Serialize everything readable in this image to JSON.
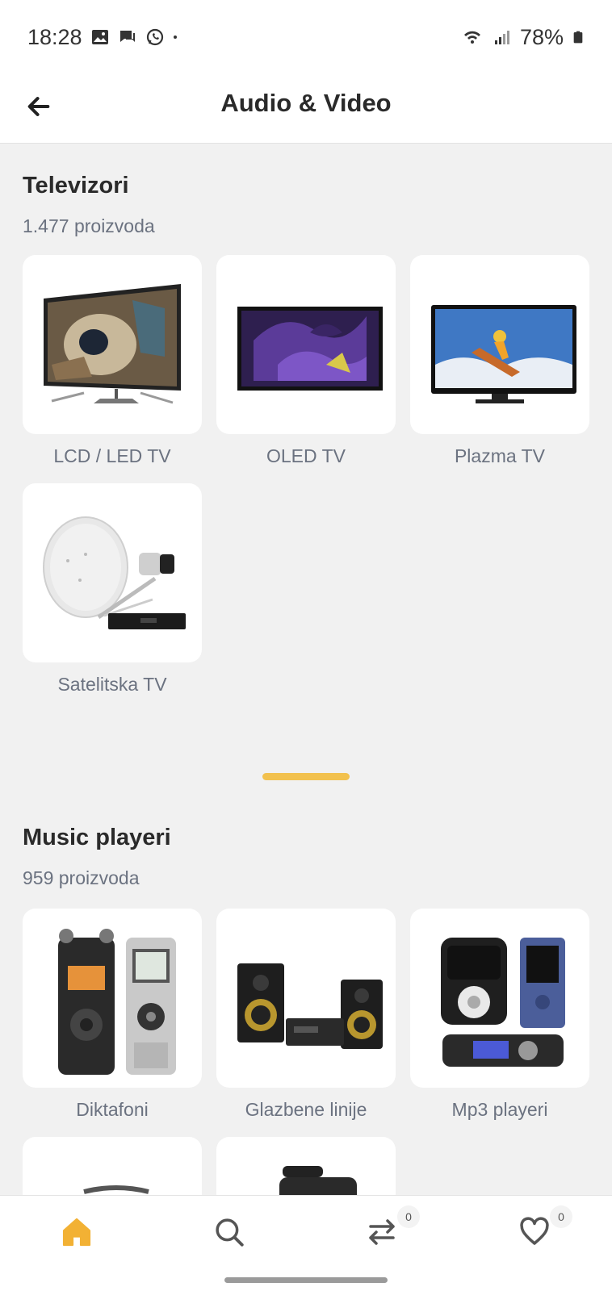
{
  "status_bar": {
    "time": "18:28",
    "battery": "78%",
    "icons_left": [
      "gallery-icon",
      "chat-icon",
      "whatsapp-icon",
      "dot-icon"
    ],
    "icons_right": [
      "wifi-icon",
      "signal-icon",
      "battery-icon"
    ]
  },
  "header": {
    "title": "Audio & Video",
    "back_icon": "arrow-left-icon"
  },
  "sections": [
    {
      "title": "Televizori",
      "count": "1.477 proizvoda",
      "items": [
        {
          "label": "LCD / LED TV"
        },
        {
          "label": "OLED TV"
        },
        {
          "label": "Plazma TV"
        },
        {
          "label": "Satelitska TV"
        }
      ]
    },
    {
      "title": "Music playeri",
      "count": "959 proizvoda",
      "items": [
        {
          "label": "Diktafoni"
        },
        {
          "label": "Glazbene linije"
        },
        {
          "label": "Mp3 playeri"
        },
        {
          "label": ""
        },
        {
          "label": ""
        }
      ]
    }
  ],
  "bottom_nav": {
    "items": [
      {
        "icon": "home-icon",
        "active": true
      },
      {
        "icon": "search-icon"
      },
      {
        "icon": "compare-icon",
        "badge": "0"
      },
      {
        "icon": "heart-icon",
        "badge": "0"
      }
    ]
  },
  "colors": {
    "accent": "#f2c14e",
    "background": "#f1f1f1",
    "muted_text": "#6b7280"
  }
}
